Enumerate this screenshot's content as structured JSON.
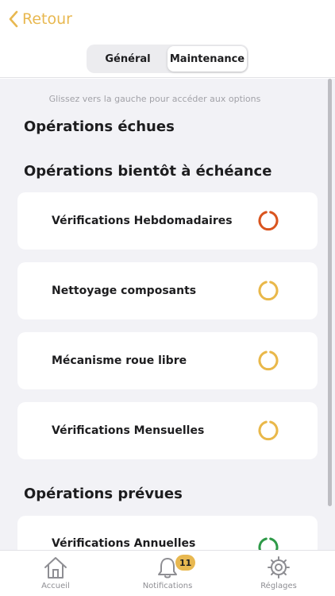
{
  "header": {
    "back_label": "Retour",
    "segments": [
      {
        "label": "Général",
        "active": false
      },
      {
        "label": "Maintenance",
        "active": true
      }
    ]
  },
  "hint": "Glissez vers la gauche pour accéder aux options",
  "sections": {
    "overdue_title": "Opérations échues",
    "due_soon_title": "Opérations bientôt à échéance",
    "planned_title": "Opérations prévues"
  },
  "due_soon_items": [
    {
      "label": "Vérifications Hebdomadaires",
      "status_color": "#d9541e"
    },
    {
      "label": "Nettoyage composants",
      "status_color": "#e9b84a"
    },
    {
      "label": "Mécanisme roue libre",
      "status_color": "#e9b84a"
    },
    {
      "label": "Vérifications Mensuelles",
      "status_color": "#e9b84a"
    }
  ],
  "planned_items": [
    {
      "label": "Vérifications Annuelles",
      "status_color": "#2e9a48"
    }
  ],
  "tabbar": {
    "home_label": "Accueil",
    "notifications_label": "Notifications",
    "notifications_count": "11",
    "settings_label": "Réglages"
  },
  "colors": {
    "accent": "#e8b850",
    "background": "#f2f2f6"
  }
}
